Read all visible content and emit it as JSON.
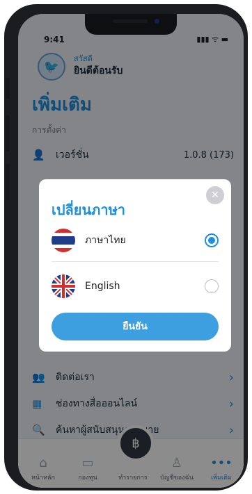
{
  "status_bar": {
    "time": "9:41",
    "icons": "▮▮▮ ᯤ ▬"
  },
  "header": {
    "greeting_small": "สวัสดี",
    "greeting_big": "ยินดีต้อนรับ"
  },
  "page_title": "เพิ่มเติม",
  "settings_section": "การตั้งค่า",
  "menu": {
    "version_label": "เวอร์ชั่น",
    "version_value": "1.0.8 (173)",
    "contact_label": "ติดต่อเรา",
    "online_label": "ช่องทางสื่อออนไลน์",
    "search_support_label": "ค้นหาผู้สนับสนุนการขาย"
  },
  "dialog": {
    "title": "เปลี่ยนภาษา",
    "close_glyph": "✕",
    "options": [
      {
        "label": "ภาษาไทย",
        "selected": true
      },
      {
        "label": "English",
        "selected": false
      }
    ],
    "confirm_label": "ยืนยัน"
  },
  "tabbar": {
    "tabs": [
      {
        "label": "หน้าหลัก",
        "icon": "home-icon"
      },
      {
        "label": "กองทุน",
        "icon": "fund-icon"
      },
      {
        "label": "ทำรายการ",
        "icon": "money-bag-icon"
      },
      {
        "label": "บัญชีของฉัน",
        "icon": "user-icon"
      },
      {
        "label": "เพิ่มเติม",
        "icon": "more-icon"
      }
    ]
  },
  "colors": {
    "accent": "#1e8fdc",
    "button": "#3d9fe0"
  }
}
